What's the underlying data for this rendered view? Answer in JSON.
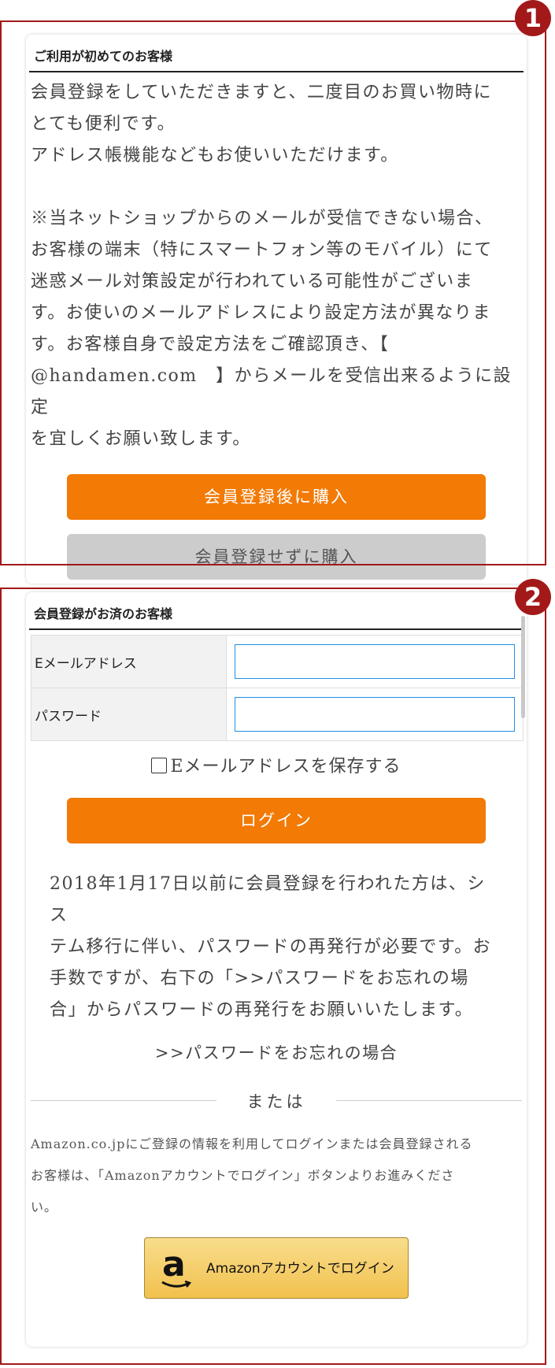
{
  "annotations": {
    "badge_1": "1",
    "badge_2": "2",
    "color": "#a31919"
  },
  "first_time": {
    "title": "ご利用が初めてのお客様",
    "paragraph_1": "会員登録をしていただきますと、二度目のお買い物時に\nとても便利です。\nアドレス帳機能などもお使いいただけます。",
    "paragraph_2": "※当ネットショップからのメールが受信できない場合、\nお客様の端末（特にスマートフォン等のモバイル）にて\n迷惑メール対策設定が行われている可能性がございま\nす。お使いのメールアドレスにより設定方法が異なりま\nす。お客様自身で設定方法をご確認頂き、【\n@handamen.com　】からメールを受信出来るように設定\nを宜しくお願い致します。",
    "register_button": "会員登録後に購入",
    "guest_button": "会員登録せずに購入"
  },
  "member": {
    "title": "会員登録がお済のお客様",
    "email_label": "Eメールアドレス",
    "email_value": "",
    "password_label": "パスワード",
    "password_value": "",
    "save_email_label": "Eメールアドレスを保存する",
    "save_email_checked": false,
    "login_button": "ログイン",
    "notice": "2018年1月17日以前に会員登録を行われた方は、シス\nテム移行に伴い、パスワードの再発行が必要です。お\n手数ですが、右下の「>>パスワードをお忘れの場\n合」からパスワードの再発行をお願いいたします。",
    "forgot_link": ">>パスワードをお忘れの場合",
    "or_label": "または",
    "amazon_note": "Amazon.co.jpにご登録の情報を利用してログインまたは会員登録される\nお客様は、「Amazonアカウントでログイン」ボタンよりお進みくださ\nい。",
    "amazon_logo": "a",
    "amazon_button": "Amazonアカウントでログイン"
  },
  "colors": {
    "accent_orange": "#f27a05",
    "input_border": "#1e90e8",
    "amazon_gold": "#f2c14e"
  }
}
